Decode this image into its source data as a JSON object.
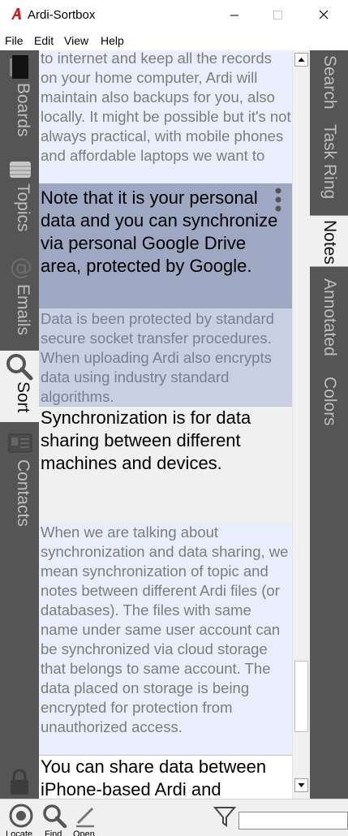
{
  "window": {
    "title": "Ardi-Sortbox",
    "logo_letter": "A",
    "brand_color": "#cc1f1f"
  },
  "menu": [
    "File",
    "Edit",
    "View",
    "Help"
  ],
  "left_tabs": [
    {
      "label": "Boards",
      "icon": "board-icon",
      "active": false
    },
    {
      "label": "Topics",
      "icon": "topics-icon",
      "active": false
    },
    {
      "label": "Emails",
      "icon": "at-sign-icon",
      "active": false
    },
    {
      "label": "Sort",
      "icon": "magnifier-icon",
      "active": true
    },
    {
      "label": "Contacts",
      "icon": "contacts-card-icon",
      "active": false
    }
  ],
  "right_tabs": [
    {
      "label": "Search",
      "active": false
    },
    {
      "label": "Task Ring",
      "active": false
    },
    {
      "label": "Notes",
      "active": true
    },
    {
      "label": "Annotated",
      "active": false
    },
    {
      "label": "Colors",
      "active": false
    }
  ],
  "notes": [
    {
      "style": "small",
      "text": "to internet and keep all the records on your home computer, Ardi will maintain also backups for you, also locally. It might be possible but it's not always practical, with mobile phones and affordable laptops we want to"
    },
    {
      "style": "large",
      "text": "Note that it is your personal data and you can synchronize via personal Google Drive area, protected by Google."
    },
    {
      "style": "small",
      "text": "Data is been protected by standard secure socket transfer procedures. When uploading Ardi also encrypts data using industry standard algorithms."
    },
    {
      "style": "large",
      "text": "Synchronization is for data sharing between different machines and devices."
    },
    {
      "style": "small",
      "text": "When we are talking about synchronization and data sharing, we mean synchronization of topic and notes between different Ardi files (or databases). The files with same name under same user account can be synchronized via cloud storage that belongs to same account. The data placed on storage is being encrypted for protection from unauthorized access."
    },
    {
      "style": "large",
      "text": "You can share data between iPhone-based Ardi and"
    }
  ],
  "bottom_toolbar": {
    "locate_label": "Locate",
    "find_label": "Find",
    "open_label": "Open",
    "filter_icon": "filter-funnel-icon",
    "filter_value": ""
  },
  "colors": {
    "sidebar_bg": "#555555",
    "note_blue": "#e8eefb",
    "selected_note": "#a8b0c8",
    "content_bg": "#f0f0f0"
  }
}
